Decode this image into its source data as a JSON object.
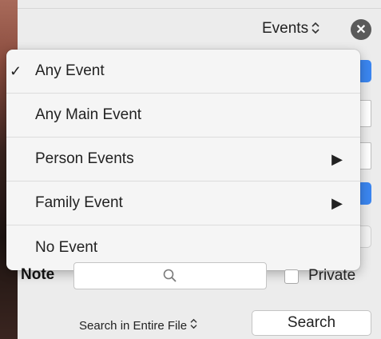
{
  "header": {
    "events_popup_label": "Events",
    "updown_glyph": "⌃⌄",
    "close_glyph": "✕"
  },
  "menu": {
    "items": [
      {
        "label": "Any Event",
        "checked": true,
        "submenu": false
      },
      {
        "label": "Any Main Event",
        "checked": false,
        "submenu": false
      },
      {
        "label": "Person Events",
        "checked": false,
        "submenu": true
      },
      {
        "label": "Family Event",
        "checked": false,
        "submenu": true
      },
      {
        "label": "No Event",
        "checked": false,
        "submenu": false
      }
    ],
    "check_glyph": "✓",
    "submenu_glyph": "▶"
  },
  "note_row": {
    "label": "Note",
    "search_value": "",
    "private_label": "Private",
    "private_checked": false
  },
  "footer": {
    "scope_label": "Search in Entire File",
    "search_button_label": "Search"
  },
  "colors": {
    "accent_blue": "#3b86f0",
    "window_bg": "#ececec",
    "menu_bg": "#f5f5f5"
  }
}
